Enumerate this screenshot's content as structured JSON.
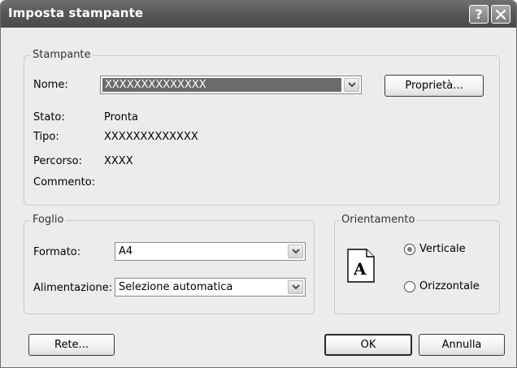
{
  "window": {
    "title": "Imposta stampante"
  },
  "printer_group": {
    "legend": "Stampante",
    "name_label": "Nome:",
    "name_value": "XXXXXXXXXXXXXX",
    "properties_button": "Proprietà...",
    "status_label": "Stato:",
    "status_value": "Pronta",
    "type_label": "Tipo:",
    "type_value": "XXXXXXXXXXXXX",
    "path_label": "Percorso:",
    "path_value": "XXXX",
    "comment_label": "Commento:"
  },
  "paper_group": {
    "legend": "Foglio",
    "size_label": "Formato:",
    "size_value": "A4",
    "source_label": "Alimentazione:",
    "source_value": "Selezione automatica"
  },
  "orientation_group": {
    "legend": "Orientamento",
    "portrait_label": "Verticale",
    "landscape_label": "Orizzontale",
    "selected": "Verticale",
    "page_icon_letter": "A"
  },
  "buttons": {
    "network": "Rete...",
    "ok": "OK",
    "cancel": "Annulla"
  },
  "icons": {
    "help": "help-icon",
    "close": "close-icon",
    "dropdown": "chevron-down-icon",
    "page": "page-portrait-icon"
  }
}
